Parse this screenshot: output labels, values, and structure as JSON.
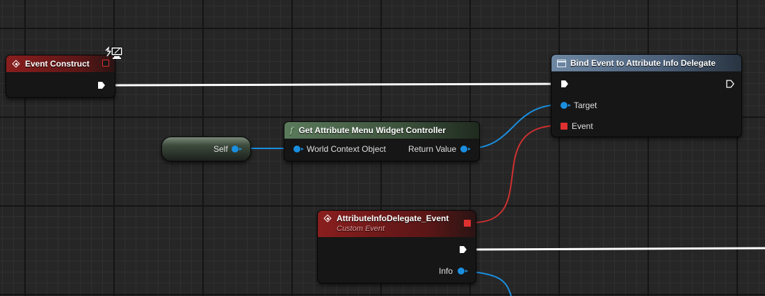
{
  "nodes": {
    "event_construct": {
      "title": "Event Construct",
      "icon": "event-diamond-icon",
      "badge_icon": "client-only-monitor-icon"
    },
    "bind_event": {
      "title": "Bind Event to Attribute Info Delegate",
      "icon": "window-icon",
      "pins": {
        "target": "Target",
        "event": "Event"
      }
    },
    "get_controller": {
      "title": "Get Attribute Menu Widget Controller",
      "icon": "function-icon",
      "pins": {
        "world_context": "World Context Object",
        "return_value": "Return Value"
      }
    },
    "self": {
      "label": "Self"
    },
    "custom_event": {
      "title": "AttributeInfoDelegate_Event",
      "subtitle": "Custom Event",
      "icon": "event-diamond-icon",
      "pins": {
        "info": "Info"
      }
    }
  },
  "colors": {
    "event_header": "#8a1e1e",
    "function_header_green": "#5b7a5b",
    "function_header_blue": "#6d87a3",
    "exec_wire": "#ffffff",
    "object_wire": "#1a8fe0",
    "delegate_wire": "#d03030",
    "grid_background": "#262626"
  }
}
